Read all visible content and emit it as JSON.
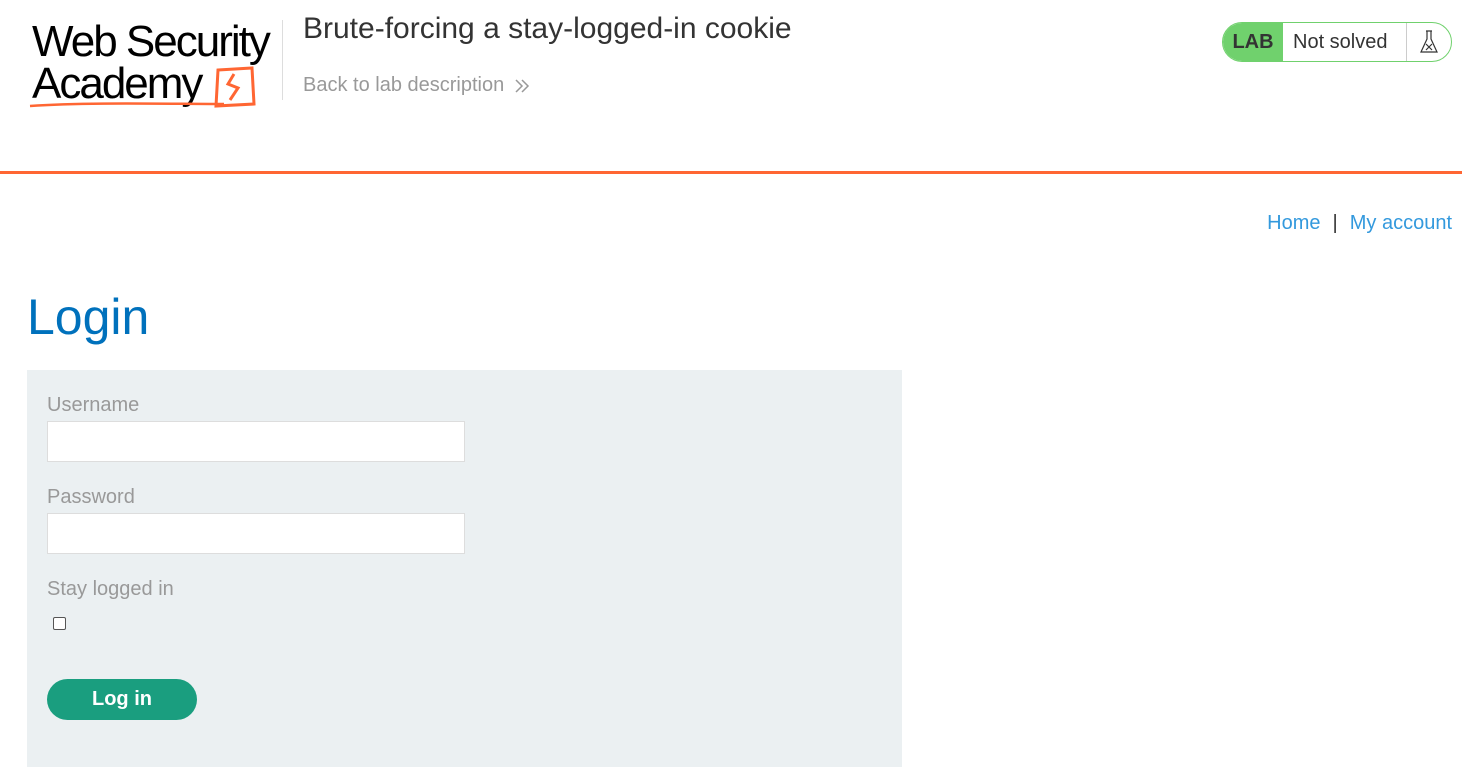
{
  "header": {
    "logo_line1": "Web Security",
    "logo_line2": "Academy",
    "lab_title": "Brute-forcing a stay-logged-in cookie",
    "back_link": "Back to lab description",
    "lab_badge": "LAB",
    "lab_status": "Not solved",
    "status_icon": "flask-icon",
    "colors": {
      "accent": "#ff6633",
      "badge": "#70d16d"
    }
  },
  "nav": {
    "home": "Home",
    "separator": "|",
    "my_account": "My account"
  },
  "page": {
    "title": "Login"
  },
  "form": {
    "username_label": "Username",
    "username_value": "",
    "password_label": "Password",
    "password_value": "",
    "stay_logged_in_label": "Stay logged in",
    "stay_logged_in_checked": false,
    "submit_label": "Log in",
    "colors": {
      "button": "#1a9e7f",
      "title": "#0071bc",
      "link": "#3399dd"
    }
  }
}
